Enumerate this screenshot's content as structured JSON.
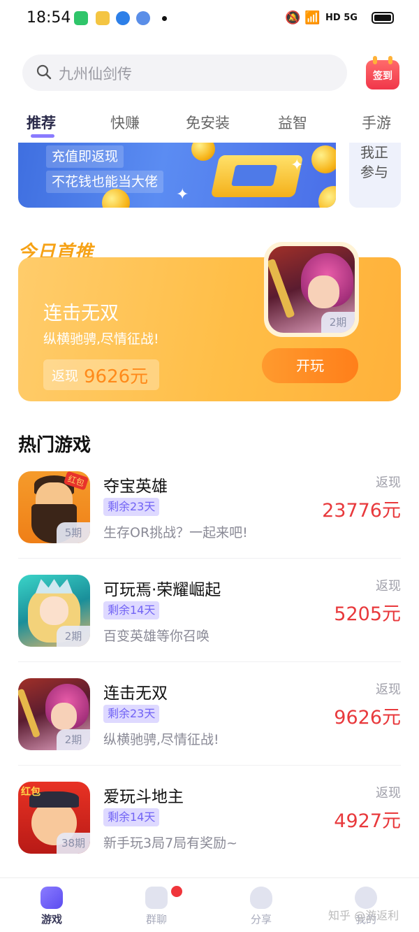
{
  "status_bar": {
    "time": "18:54",
    "network": "HD 5G"
  },
  "search": {
    "placeholder": "九州仙剑传"
  },
  "signin": {
    "label": "签到"
  },
  "tabs": [
    {
      "label": "推荐",
      "active": true
    },
    {
      "label": "快赚"
    },
    {
      "label": "免安装"
    },
    {
      "label": "益智"
    },
    {
      "label": "手游"
    }
  ],
  "banner": {
    "line1": "充值即返现",
    "line2": "不花钱也能当大佬"
  },
  "side_card": {
    "text": "我正参与"
  },
  "today": {
    "title": "今日首推",
    "name": "连击无双",
    "slogan": "纵横驰骋,尽情征战!",
    "cash_label": "返现",
    "cash_value": "9626元",
    "period": "2期",
    "play_label": "开玩"
  },
  "hot": {
    "title": "热门游戏",
    "games": [
      {
        "name": "夺宝英雄",
        "remain": "剩余23天",
        "desc": "生存OR挑战？一起来吧!",
        "rebate_label": "返现",
        "rebate": "23776元",
        "period": "5期",
        "icon": "beard-hero-icon",
        "icon_tag": "红包"
      },
      {
        "name": "可玩焉·荣耀崛起",
        "remain": "剩余14天",
        "desc": "百变英雄等你召唤",
        "rebate_label": "返现",
        "rebate": "5205元",
        "period": "2期",
        "icon": "knight-girl-icon"
      },
      {
        "name": "连击无双",
        "remain": "剩余23天",
        "desc": "纵横驰骋,尽情征战!",
        "rebate_label": "返现",
        "rebate": "9626元",
        "period": "2期",
        "icon": "warrior-girl-icon"
      },
      {
        "name": "爱玩斗地主",
        "remain": "剩余14天",
        "desc": "新手玩3局7局有奖励~",
        "rebate_label": "返现",
        "rebate": "4927元",
        "period": "38期",
        "icon": "landlord-icon",
        "icon_tag": "红包"
      }
    ]
  },
  "bottom_nav": [
    {
      "label": "游戏",
      "active": true
    },
    {
      "label": "群聊"
    },
    {
      "label": "分享"
    },
    {
      "label": "我的"
    }
  ],
  "watermark": "知乎 @游返利",
  "colors": {
    "accent": "#8a7bff",
    "rebate": "#e8393c",
    "feature": "#ffbe47"
  }
}
